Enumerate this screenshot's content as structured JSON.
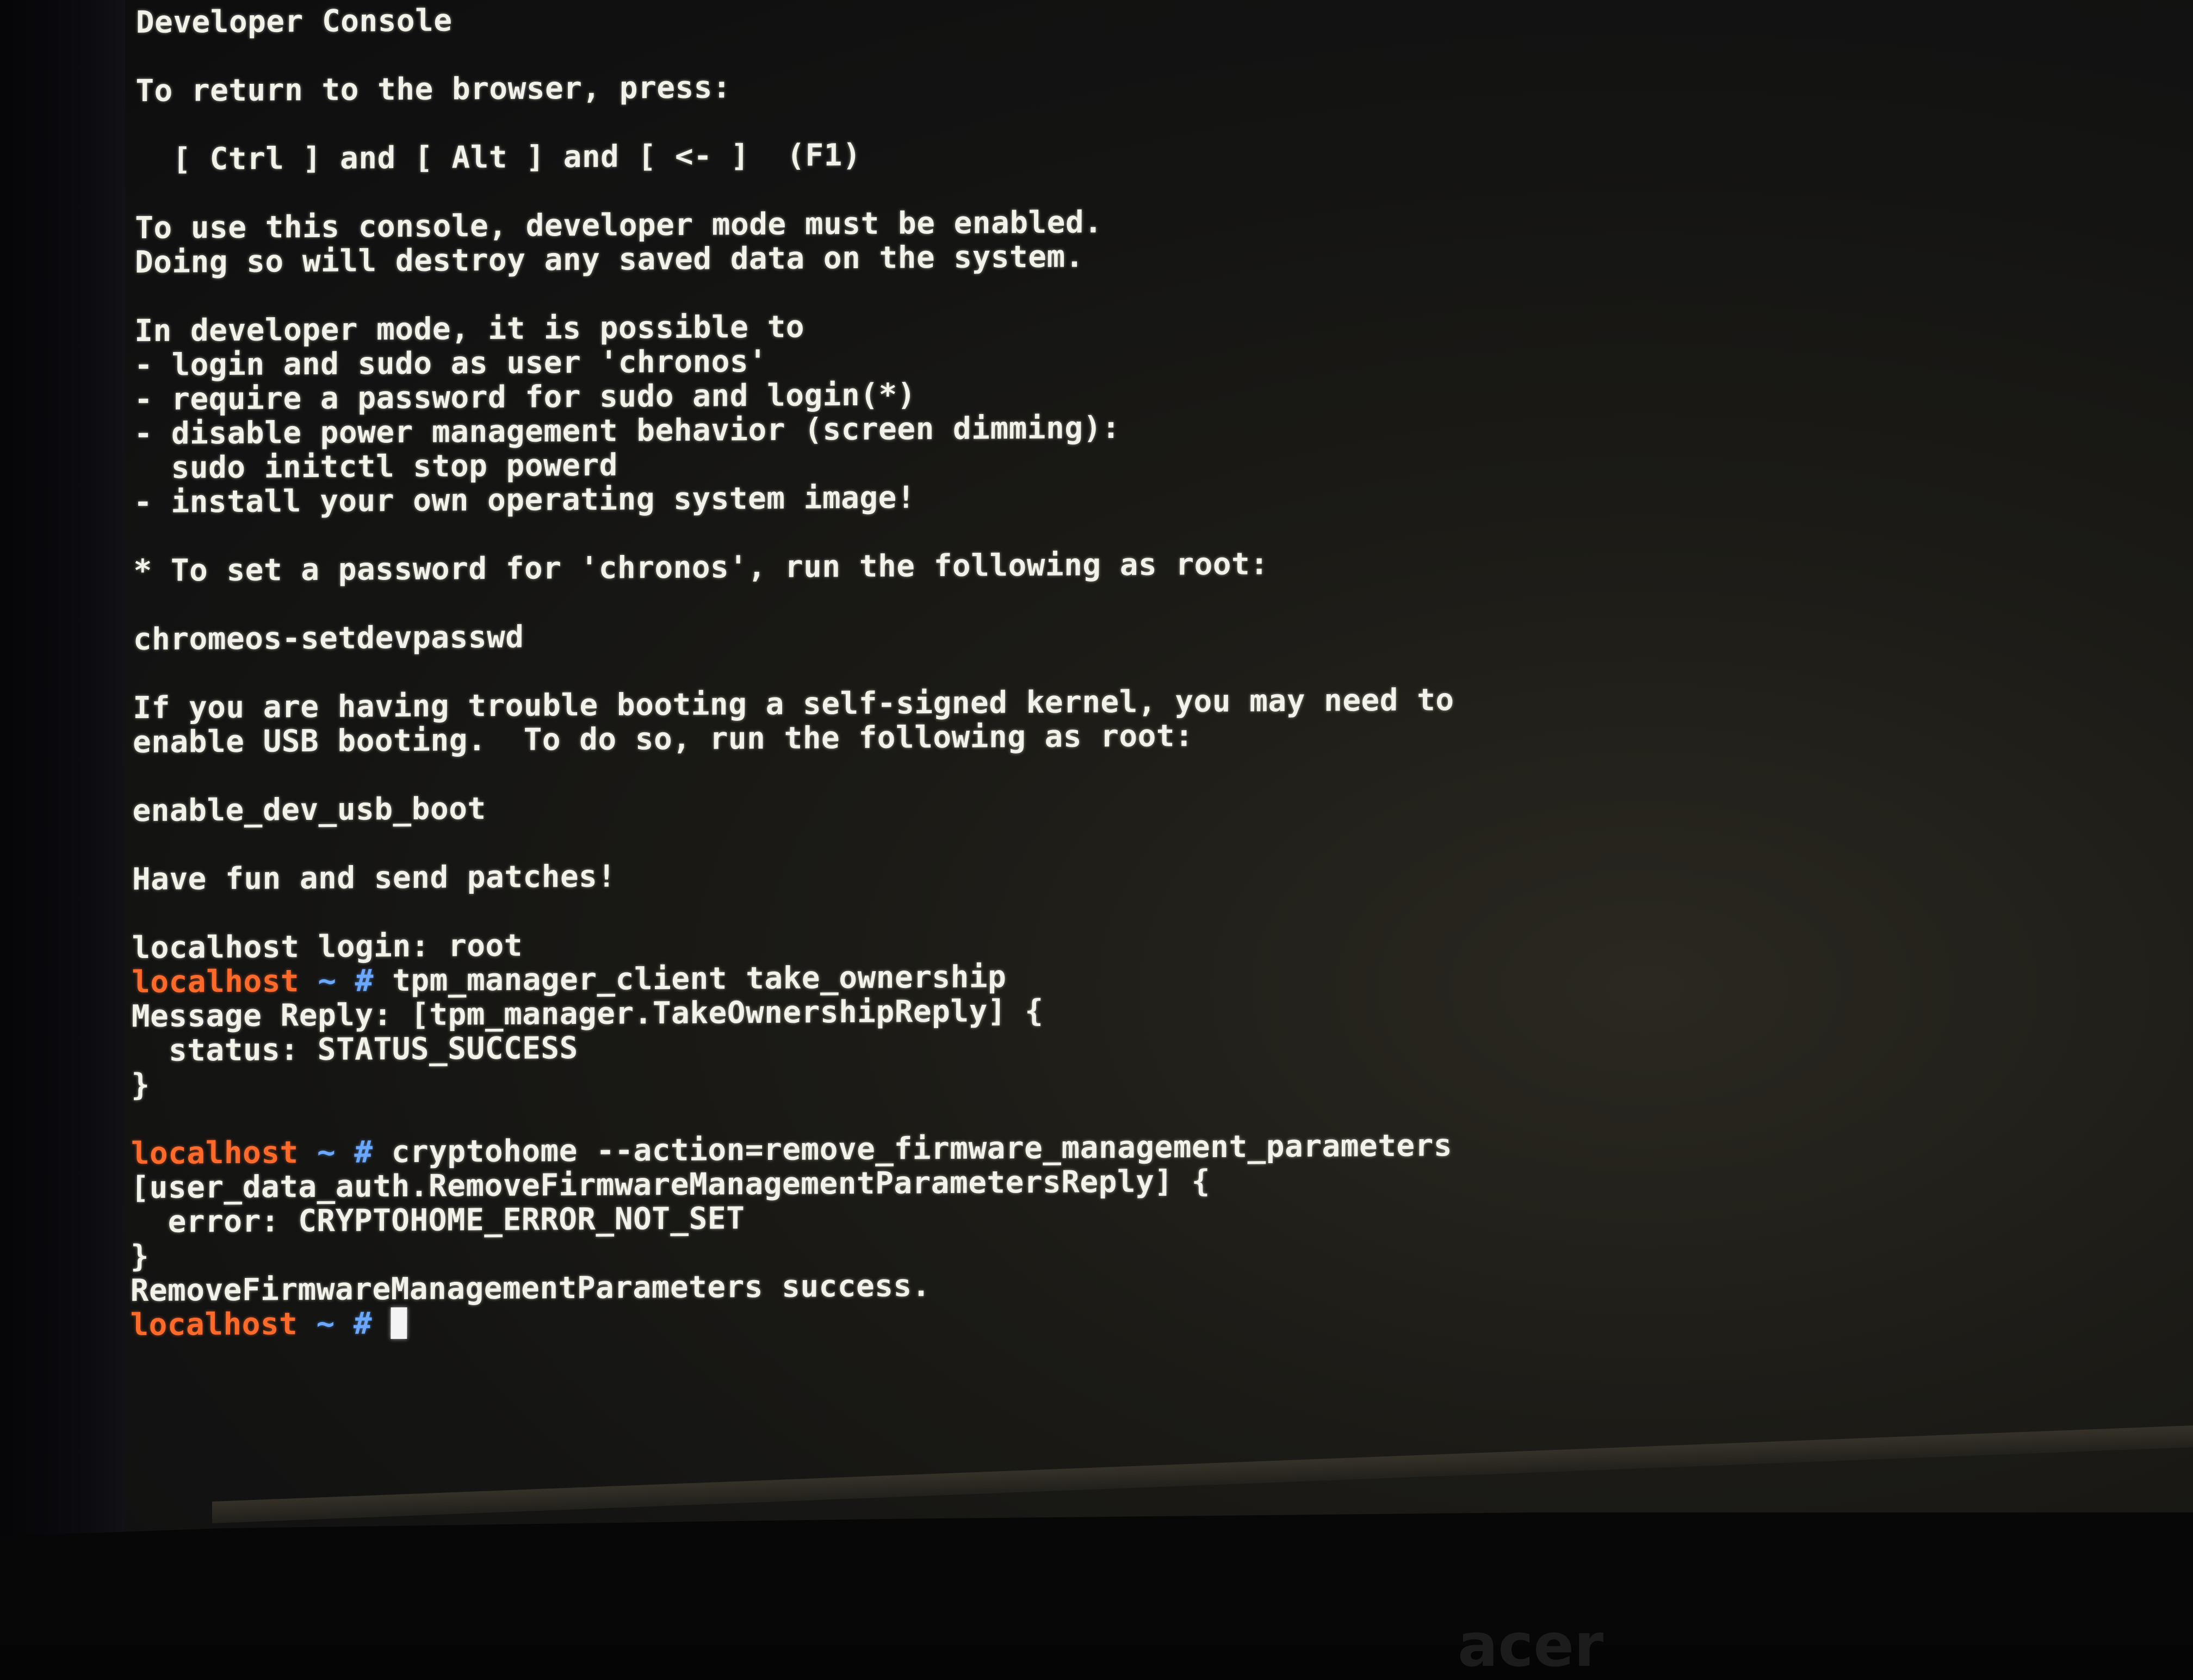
{
  "console": {
    "title": "Developer Console",
    "return_instruction": "To return to the browser, press:",
    "key_combo": "  [ Ctrl ] and [ Alt ] and [ <- ]  (F1)",
    "warning_1": "To use this console, developer mode must be enabled.",
    "warning_2": "Doing so will destroy any saved data on the system.",
    "possible_header": "In developer mode, it is possible to",
    "possible_items": [
      "- login and sudo as user 'chronos'",
      "- require a password for sudo and login(*)",
      "- disable power management behavior (screen dimming):",
      "  sudo initctl stop powerd",
      "- install your own operating system image!"
    ],
    "password_note": "* To set a password for 'chronos', run the following as root:",
    "password_cmd": "chromeos-setdevpasswd",
    "usb_note_1": "If you are having trouble booting a self-signed kernel, you may need to",
    "usb_note_2": "enable USB booting.  To do so, run the following as root:",
    "usb_cmd": "enable_dev_usb_boot",
    "farewell": "Have fun and send patches!",
    "login_line": "localhost login: root"
  },
  "prompt": {
    "host": "localhost",
    "symbol": " ~ # ",
    "host_color": "#ff6a2a",
    "symbol_color": "#6aa8ff"
  },
  "session": {
    "cmd_1": "tpm_manager_client take_ownership",
    "reply_1_open": "Message Reply: [tpm_manager.TakeOwnershipReply] {",
    "reply_1_status": "  status: STATUS_SUCCESS",
    "reply_1_close": "}",
    "cmd_2": "cryptohome --action=remove_firmware_management_parameters",
    "reply_2_open": "[user_data_auth.RemoveFirmwareManagementParametersReply] {",
    "reply_2_error": "  error: CRYPTOHOME_ERROR_NOT_SET",
    "reply_2_close": "}",
    "result": "RemoveFirmwareManagementParameters success."
  },
  "monitor": {
    "brand": "acer"
  }
}
